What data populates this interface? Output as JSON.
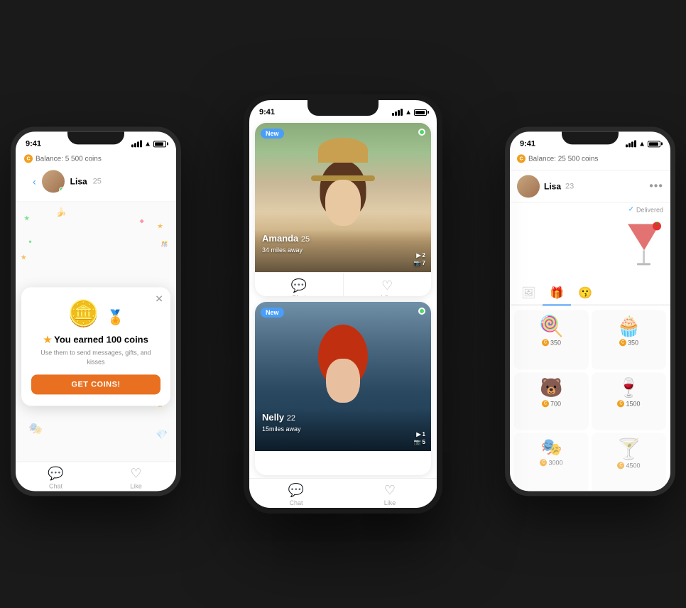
{
  "phones": {
    "center": {
      "time": "9:41",
      "cards": [
        {
          "id": "amanda",
          "name": "Amanda",
          "age": "25",
          "distance": "34 miles away",
          "badge": "New",
          "online": true,
          "photo_count_video": "2",
          "photo_count_camera": "7",
          "photo_bg": "green_field"
        },
        {
          "id": "nelly",
          "name": "Nelly",
          "age": "22",
          "distance": "15miles away",
          "badge": "New",
          "online": true,
          "photo_count_video": "1",
          "photo_count_camera": "5",
          "photo_bg": "blue_bg"
        }
      ],
      "bottom_tabs": [
        {
          "id": "chat",
          "label": "Chat",
          "icon": "💬"
        },
        {
          "id": "like",
          "label": "Like",
          "icon": "♡"
        }
      ]
    },
    "left": {
      "time": "9:41",
      "balance": "Balance: 5 500 coins",
      "chat_person": "Lisa",
      "chat_age": "25",
      "popup": {
        "title": "You earned 100 coins",
        "description": "Use them to send messages, gifts, and kisses",
        "button_label": "GET COINS!",
        "coins_amount": "100"
      },
      "decorations": [
        "🌹",
        "🎊",
        "⭐",
        "🍌",
        "🎭"
      ]
    },
    "right": {
      "time": "9:41",
      "balance": "Balance: 25 500 coins",
      "chat_person": "Lisa",
      "chat_age": "23",
      "delivered_text": "Delivered",
      "cocktail_gift": "🍸",
      "gift_tabs": [
        {
          "id": "sticker",
          "icon": "🖼",
          "active": false
        },
        {
          "id": "gift",
          "icon": "🎁",
          "active": true
        },
        {
          "id": "kiss",
          "icon": "😗",
          "active": false
        }
      ],
      "gifts": [
        {
          "emoji": "🍭",
          "price": "350"
        },
        {
          "emoji": "🧁",
          "price": "350"
        },
        {
          "emoji": "🐻",
          "price": "700"
        },
        {
          "emoji": "🍷",
          "price": "1500"
        },
        {
          "emoji": "🎭",
          "price": "3000"
        },
        {
          "emoji": "🍸",
          "price": "4500"
        }
      ]
    }
  },
  "delivered_check": "✓",
  "bottom_chat_label": "Chat",
  "bottom_like_label": "Like"
}
